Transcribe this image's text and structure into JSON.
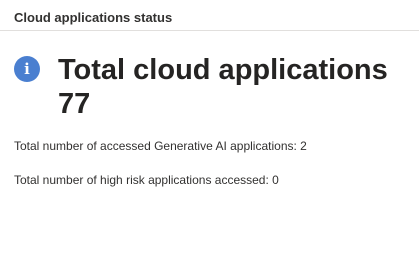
{
  "card": {
    "title": "Cloud applications status",
    "icon": "info-icon",
    "headline_label": "Total cloud applications",
    "headline_count": "77",
    "stats": [
      {
        "label": "Total number of accessed Generative AI applications:",
        "value": "2"
      },
      {
        "label": "Total number of high risk applications accessed:",
        "value": "0"
      }
    ]
  },
  "colors": {
    "info_icon": "#4a7fd0",
    "divider": "#e1dfdd",
    "text": "#323130"
  }
}
